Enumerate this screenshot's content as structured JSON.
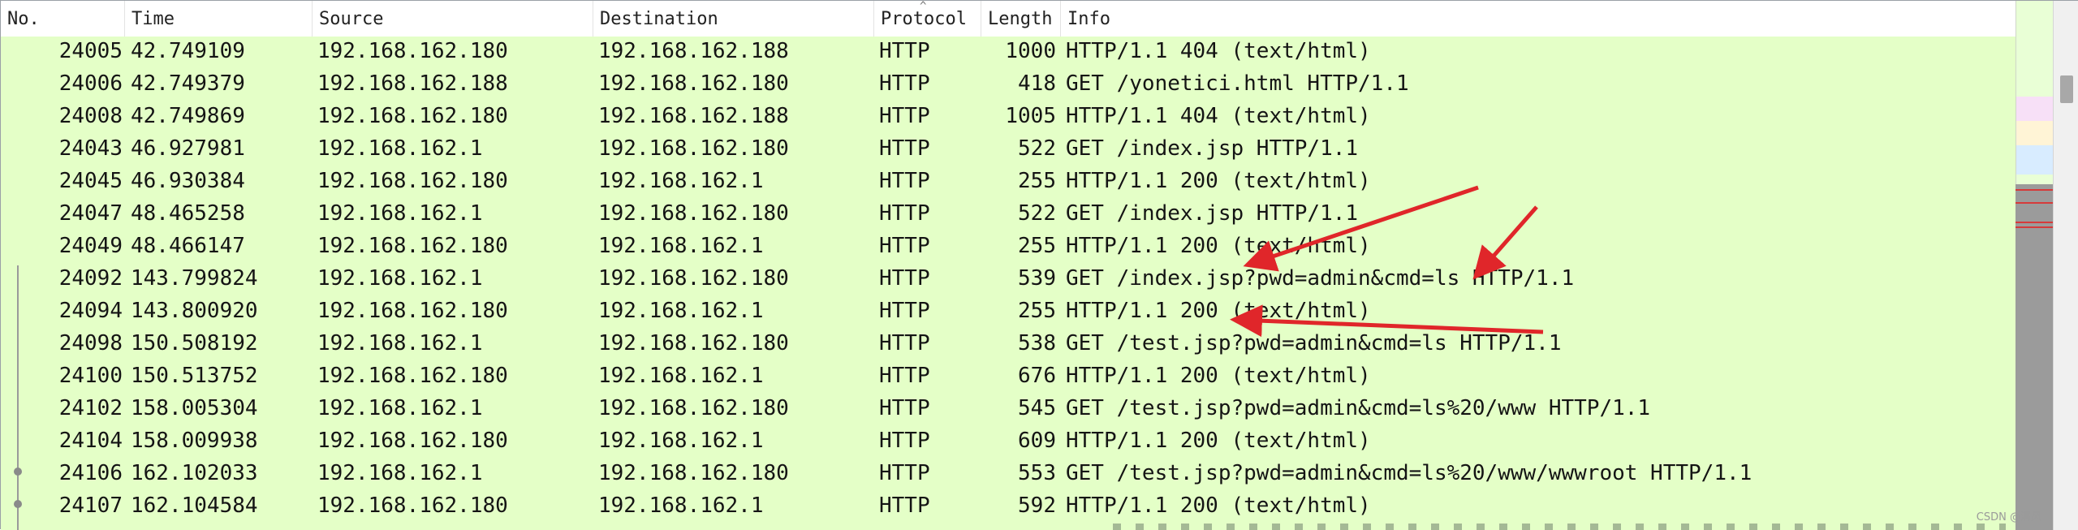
{
  "columns": {
    "no": "No.",
    "time": "Time",
    "source": "Source",
    "destination": "Destination",
    "protocol": "Protocol",
    "length": "Length",
    "info": "Info"
  },
  "packets": [
    {
      "no": "24005",
      "time": "42.749109",
      "source": "192.168.162.180",
      "destination": "192.168.162.188",
      "protocol": "HTTP",
      "length": "1000",
      "info": "HTTP/1.1 404   (text/html)"
    },
    {
      "no": "24006",
      "time": "42.749379",
      "source": "192.168.162.188",
      "destination": "192.168.162.180",
      "protocol": "HTTP",
      "length": "418",
      "info": "GET /yonetici.html HTTP/1.1"
    },
    {
      "no": "24008",
      "time": "42.749869",
      "source": "192.168.162.180",
      "destination": "192.168.162.188",
      "protocol": "HTTP",
      "length": "1005",
      "info": "HTTP/1.1 404   (text/html)"
    },
    {
      "no": "24043",
      "time": "46.927981",
      "source": "192.168.162.1",
      "destination": "192.168.162.180",
      "protocol": "HTTP",
      "length": "522",
      "info": "GET /index.jsp HTTP/1.1"
    },
    {
      "no": "24045",
      "time": "46.930384",
      "source": "192.168.162.180",
      "destination": "192.168.162.1",
      "protocol": "HTTP",
      "length": "255",
      "info": "HTTP/1.1 200   (text/html)"
    },
    {
      "no": "24047",
      "time": "48.465258",
      "source": "192.168.162.1",
      "destination": "192.168.162.180",
      "protocol": "HTTP",
      "length": "522",
      "info": "GET /index.jsp HTTP/1.1"
    },
    {
      "no": "24049",
      "time": "48.466147",
      "source": "192.168.162.180",
      "destination": "192.168.162.1",
      "protocol": "HTTP",
      "length": "255",
      "info": "HTTP/1.1 200   (text/html)"
    },
    {
      "no": "24092",
      "time": "143.799824",
      "source": "192.168.162.1",
      "destination": "192.168.162.180",
      "protocol": "HTTP",
      "length": "539",
      "info": "GET /index.jsp?pwd=admin&cmd=ls HTTP/1.1"
    },
    {
      "no": "24094",
      "time": "143.800920",
      "source": "192.168.162.180",
      "destination": "192.168.162.1",
      "protocol": "HTTP",
      "length": "255",
      "info": "HTTP/1.1 200   (text/html)"
    },
    {
      "no": "24098",
      "time": "150.508192",
      "source": "192.168.162.1",
      "destination": "192.168.162.180",
      "protocol": "HTTP",
      "length": "538",
      "info": "GET /test.jsp?pwd=admin&cmd=ls HTTP/1.1"
    },
    {
      "no": "24100",
      "time": "150.513752",
      "source": "192.168.162.180",
      "destination": "192.168.162.1",
      "protocol": "HTTP",
      "length": "676",
      "info": "HTTP/1.1 200   (text/html)"
    },
    {
      "no": "24102",
      "time": "158.005304",
      "source": "192.168.162.1",
      "destination": "192.168.162.180",
      "protocol": "HTTP",
      "length": "545",
      "info": "GET /test.jsp?pwd=admin&cmd=ls%20/www HTTP/1.1"
    },
    {
      "no": "24104",
      "time": "158.009938",
      "source": "192.168.162.180",
      "destination": "192.168.162.1",
      "protocol": "HTTP",
      "length": "609",
      "info": "HTTP/1.1 200   (text/html)"
    },
    {
      "no": "24106",
      "time": "162.102033",
      "source": "192.168.162.1",
      "destination": "192.168.162.180",
      "protocol": "HTTP",
      "length": "553",
      "info": "GET /test.jsp?pwd=admin&cmd=ls%20/www/wwwroot HTTP/1.1"
    },
    {
      "no": "24107",
      "time": "162.104584",
      "source": "192.168.162.180",
      "destination": "192.168.162.1",
      "protocol": "HTTP",
      "length": "592",
      "info": "HTTP/1.1 200   (text/html)"
    }
  ],
  "colors": {
    "row_background": "#e4ffc7",
    "annotation_arrow": "#e0262a"
  },
  "icons": {
    "sort_indicator": "caret-up-icon"
  },
  "watermark": "CSDN @清风"
}
